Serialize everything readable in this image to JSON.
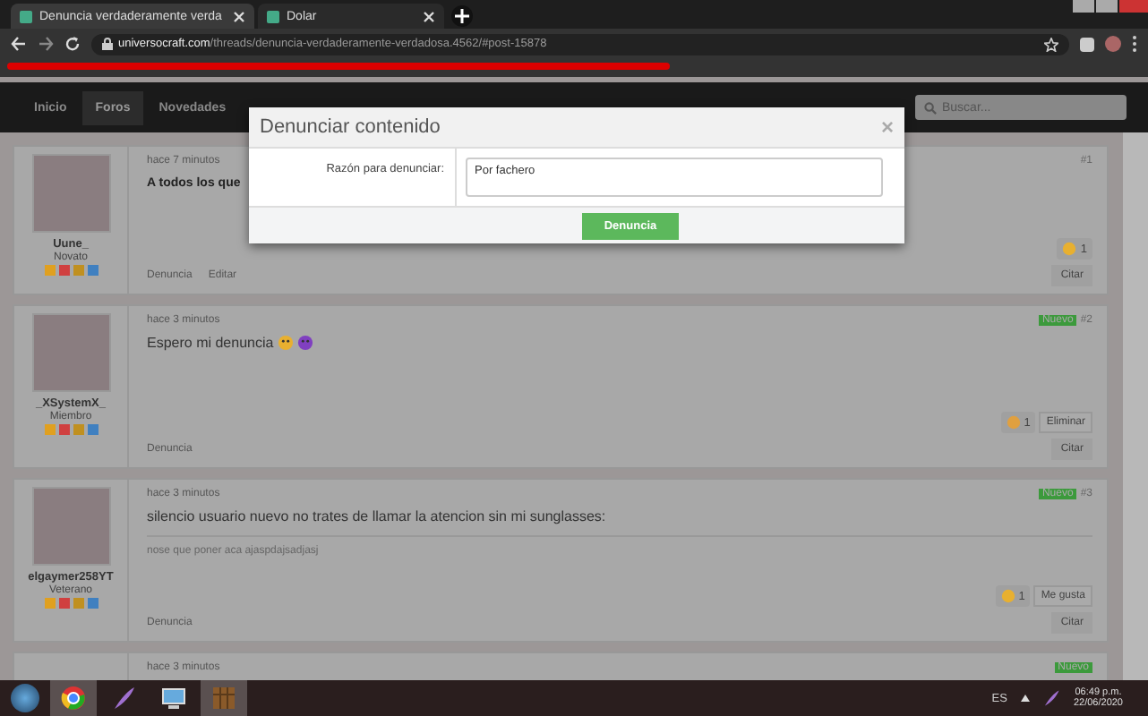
{
  "browser": {
    "tabs": [
      {
        "title": "Denuncia verdaderamente verda",
        "selected": true
      },
      {
        "title": "Dolar",
        "selected": false
      }
    ],
    "url_host": "universocraft.com",
    "url_path": "/threads/denuncia-verdaderamente-verdadosa.4562/#post-15878"
  },
  "site_nav": {
    "items": [
      {
        "label": "Inicio",
        "selected": false
      },
      {
        "label": "Foros",
        "selected": true
      },
      {
        "label": "Novedades",
        "selected": false
      }
    ],
    "search_placeholder": "Buscar..."
  },
  "posts": [
    {
      "username": "Uune_",
      "role": "Novato",
      "time": "hace 7 minutos",
      "number": "#1",
      "title": "A todos los que",
      "reactions": [
        {
          "kind": "love",
          "count": "1"
        }
      ],
      "actions": [
        "Denuncia",
        "Editar"
      ],
      "quote": "Citar"
    },
    {
      "username": "_XSystemX_",
      "role": "Miembro",
      "time": "hace 3 minutos",
      "number": "#2",
      "new_badge": "Nuevo",
      "body": "Espero mi denuncia",
      "emojis": [
        {
          "kind": "flushed"
        },
        {
          "kind": "devil"
        }
      ],
      "reactions": [
        {
          "kind": "like",
          "count": "1"
        }
      ],
      "actions": [
        "Denuncia"
      ],
      "button": "Eliminar",
      "quote": "Citar"
    },
    {
      "username": "elgaymer258YT",
      "role": "Veterano",
      "time": "hace 3 minutos",
      "number": "#3",
      "new_badge": "Nuevo",
      "body": "silencio usuario nuevo no trates de llamar la atencion sin mi sunglasses:",
      "signature": "nose que poner aca ajaspdajsadjasj",
      "reactions": [
        {
          "kind": "laugh",
          "count": "1"
        }
      ],
      "actions": [
        "Denuncia"
      ],
      "button": "Me gusta",
      "quote": "Citar"
    },
    {
      "time": "hace 3 minutos",
      "new_badge": "Nuevo"
    }
  ],
  "modal": {
    "title": "Denunciar contenido",
    "close": "×",
    "field_label": "Razón para denunciar:",
    "field_value": "Por fachero",
    "submit": "Denuncia"
  },
  "taskbar": {
    "language": "ES",
    "time": "06:49 p.m.",
    "date": "22/06/2020"
  }
}
